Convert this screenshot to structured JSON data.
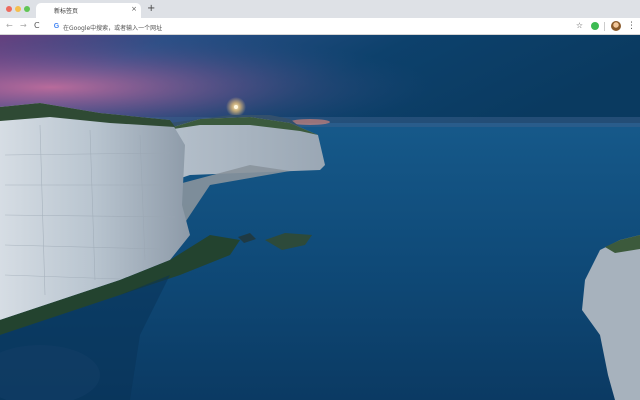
{
  "window": {
    "tab": {
      "title": "新标签页",
      "close_symbol": "×"
    },
    "new_tab_symbol": "+"
  },
  "toolbar": {
    "back_symbol": "←",
    "forward_symbol": "→",
    "reload_symbol": "C",
    "omnibox": {
      "icon_letter": "G",
      "placeholder": "在Google中搜索，或者输入一个网址"
    },
    "bookmark_symbol": "☆",
    "menu_symbol": "⋮"
  },
  "background": {
    "scene": "coastal-cliffs-night",
    "colors": {
      "sky_top": "#0b3b63",
      "sky_glow": "#c86aa8",
      "sea": "#0f4a78",
      "cliff": "#c9d3dc"
    }
  }
}
